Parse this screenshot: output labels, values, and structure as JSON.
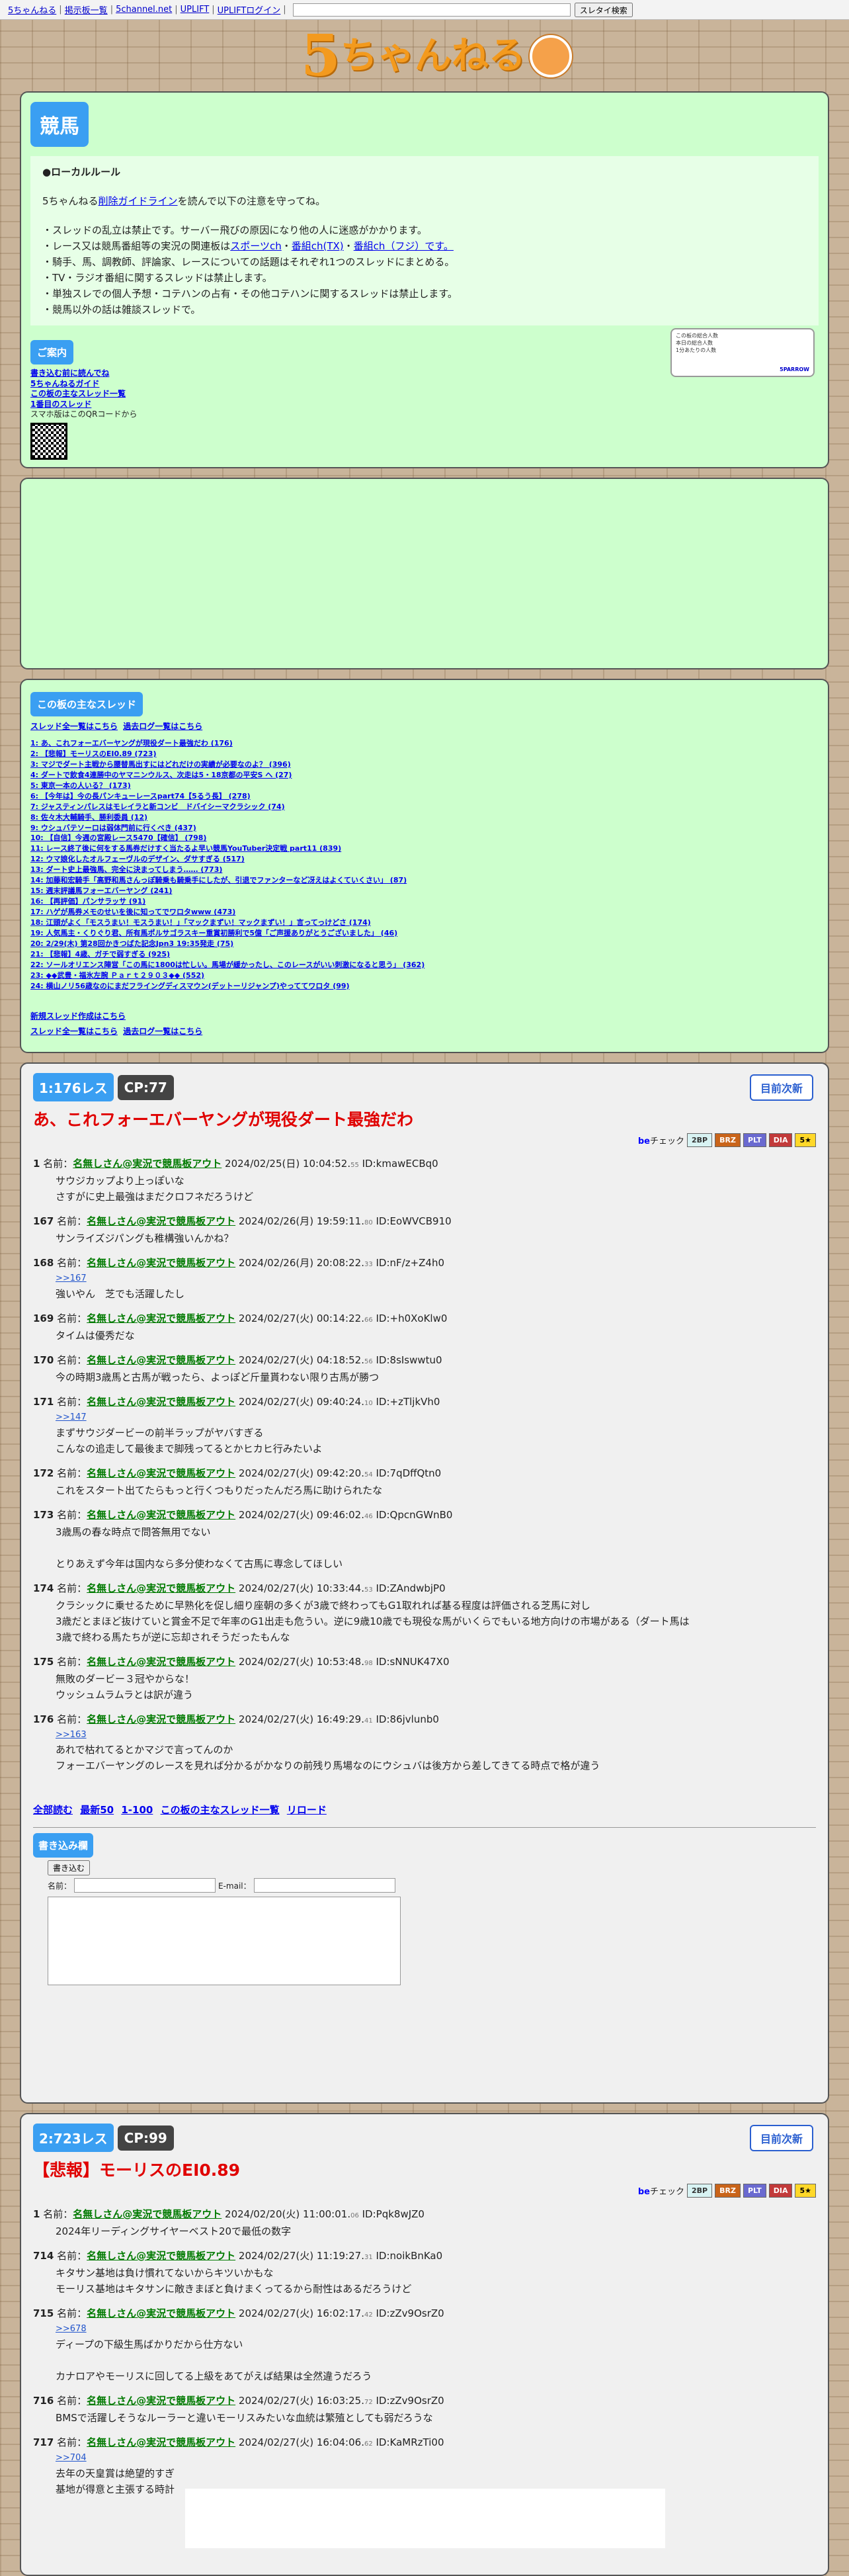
{
  "topbar": {
    "links": [
      "5ちゃんねる",
      "掲示板一覧",
      "5channel.net",
      "UPLIFT",
      "UPLIFTログイン"
    ],
    "search_placeholder": "",
    "search_button": "スレタイ検索"
  },
  "logo": {
    "text_big": "5",
    "text_rest": "ちゃんねる"
  },
  "board": {
    "title": "競馬",
    "rules_heading": "●ローカルルール",
    "rules_intro_pre": "5ちゃんねる",
    "rules_intro_link": "削除ガイドライン",
    "rules_intro_post": "を読んで以下の注意を守ってね。",
    "rule1": "・スレッドの乱立は禁止です。サーバー飛びの原因になり他の人に迷惑がかかります。",
    "rule2_pre": "・レース又は競馬番組等の実況の関連板は",
    "rule2_link1": "スポーツch",
    "rule2_sep1": "・",
    "rule2_link2": "番組ch(TX)",
    "rule2_sep2": "・",
    "rule2_link3": "番組ch（フジ）です。",
    "rule3": "・騎手、馬、調教師、評論家、レースについての話題はそれぞれ1つのスレッドにまとめる。",
    "rule4": "・TV・ラジオ番組に関するスレッドは禁止します。",
    "rule5": "・単独スレでの個人予想・コテハンの占有・その他コテハンに関するスレッドは禁止します。",
    "rule6": "・競馬以外の話は雑談スレッドで。"
  },
  "guide": {
    "tag": "ご案内",
    "links": [
      "書き込む前に読んでね",
      "5ちゃんねるガイド",
      "この板の主なスレッド一覧",
      "1番目のスレッド"
    ],
    "qr_note": "スマホ版はこのQRコードから"
  },
  "stats": {
    "line1": "この板の総合人数",
    "line2": "本日の総合人数",
    "line3": "1分あたりの人数",
    "link": "5PARROW"
  },
  "threads": {
    "tag": "この板の主なスレッド",
    "top_links": [
      "スレッド全一覧はこちら",
      "過去ログ一覧はこちら"
    ],
    "items": [
      "1: あ、これフォーエバーヤングが現役ダート最強だわ (176)",
      "2: 【悲報】モーリスのEI0.89 (723)",
      "3: マジでダート主戦から腰替馬出すにはどれだけの実績が必要なのよ？ (396)",
      "4: ダートで飲食4連勝中のヤマニンウルス、次走は5・18京都の平安S へ (27)",
      "5: 東京一本の人いる？ (173)",
      "6: 【今年は】今の長パンキューレースpart74【5るう長】 (278)",
      "7: ジャスティンパレスはモレイラと新コンビ　ドバイシーマクラシック (74)",
      "8: 佐々木大輔騎手、勝利委員 (12)",
      "9: ウシュバテソーロは弱体門前に行くべき (437)",
      "10: 【自信】今週の宮殿レース5470【確信】 (798)",
      "11: レース終了後に何をする馬券だけすく当たるよ早い競馬YouTuber決定戦 part11 (839)",
      "12: ウマ娘化したオルフェーヴルのデザイン、ダサすぎる (517)",
      "13: ダート史上最強馬、完全に決まってしまう…… (773)",
      "14: 加藤和宏騎手「高野和馬さんっぽ騎乗も騎乗手にしたが、引退でファンターなど冴えはよくていくさい」 (87)",
      "15: 週末評議馬フォーエバーヤング (241)",
      "16: 【再評価】パンサラッサ (91)",
      "17: ハゲが馬券メモのせいを後に知ってでワロタwww (473)",
      "18: 江頭がよく「モスうまい！モスうまい！」「マックまずい！マックまずい！」言ってっけどさ (174)",
      "19: 人気馬主・くりぐり君、所有馬ポルサゴラスキー重賞初勝利で5億「ご声援ありがとうございました」 (46)",
      "20: 2/29(木) 第28回かきつばた記念Jpn3 19:35発走 (75)",
      "21: 【悲報】4歳、ガチで弱すぎる (925)",
      "22: ソールオリエンス陣営「この馬に1800は忙しい。馬場が緩かったし、このレースがいい刺激になると思う」 (362)",
      "23: ◆◆武豊・福氷左腕 Ｐａｒｔ２９０３◆◆ (552)",
      "24: 横山ノリ56歳なのにまだフライングディスマウン(デットーリジャンプ)やっててワロタ (99)"
    ],
    "bottom_new": "新規スレッド作成はこちら",
    "bottom_links": [
      "スレッド全一覧はこちら",
      "過去ログ一覧はこちら"
    ]
  },
  "thread1": {
    "res_count": "1:176レス",
    "cp": "CP:77",
    "refresh": "目前次新",
    "title": "あ、これフォーエバーヤングが現役ダート最強だわ",
    "be_label": "be",
    "be_check": "チェック",
    "tags": [
      "2BP",
      "BRZ",
      "PLT",
      "DIA",
      "5★"
    ],
    "posts": [
      {
        "num": "1",
        "label": "名前：",
        "name": "名無しさん@実況で競馬板アウト",
        "date": "2024/02/25(日) 10:04:52.",
        "ms": "55",
        "id": "ID:kmawECBq0",
        "lines": [
          "サウジカップより上っぽいな",
          "さすがに史上最強はまだクロフネだろうけど"
        ]
      },
      {
        "num": "167",
        "label": "名前：",
        "name": "名無しさん@実況で競馬板アウト",
        "date": "2024/02/26(月) 19:59:11.",
        "ms": "80",
        "id": "ID:EoWVCB910",
        "lines": [
          "サンライズジパングも稚構強いんかね？"
        ]
      },
      {
        "num": "168",
        "label": "名前：",
        "name": "名無しさん@実況で競馬板アウト",
        "date": "2024/02/26(月) 20:08:22.",
        "ms": "33",
        "id": "ID:nF/z+Z4h0",
        "anchor": ">>167",
        "lines": [
          "強いやん　芝でも活躍したし"
        ]
      },
      {
        "num": "169",
        "label": "名前：",
        "name": "名無しさん@実況で競馬板アウト",
        "date": "2024/02/27(火) 00:14:22.",
        "ms": "66",
        "id": "ID:+h0XoKlw0",
        "lines": [
          "タイムは優秀だな"
        ]
      },
      {
        "num": "170",
        "label": "名前：",
        "name": "名無しさん@実況で競馬板アウト",
        "date": "2024/02/27(火) 04:18:52.",
        "ms": "56",
        "id": "ID:8sIswwtu0",
        "lines": [
          "今の時期3歳馬と古馬が戦ったら、よっぽど斤量貰わない限り古馬が勝つ"
        ]
      },
      {
        "num": "171",
        "label": "名前：",
        "name": "名無しさん@実況で競馬板アウト",
        "date": "2024/02/27(火) 09:40:24.",
        "ms": "10",
        "id": "ID:+zTljkVh0",
        "anchor": ">>147",
        "lines": [
          "まずサウジダービーの前半ラップがヤバすぎる",
          "こんなの追走して最後まで脚残ってるとかヒカヒ行みたいよ"
        ]
      },
      {
        "num": "172",
        "label": "名前：",
        "name": "名無しさん@実況で競馬板アウト",
        "date": "2024/02/27(火) 09:42:20.",
        "ms": "54",
        "id": "ID:7qDffQtn0",
        "lines": [
          "これをスタート出てたらもっと行くつもりだったんだろ馬に助けられたな"
        ]
      },
      {
        "num": "173",
        "label": "名前：",
        "name": "名無しさん@実況で競馬板アウト",
        "date": "2024/02/27(火) 09:46:02.",
        "ms": "46",
        "id": "ID:QpcnGWnB0",
        "lines": [
          "3歳馬の春な時点で問答無用でない",
          "",
          "とりあえず今年は国内なら多分使わなくて古馬に専念してほしい"
        ]
      },
      {
        "num": "174",
        "label": "名前：",
        "name": "名無しさん@実況で競馬板アウト",
        "date": "2024/02/27(火) 10:33:44.",
        "ms": "53",
        "id": "ID:ZAndwbjP0",
        "lines": [
          "クラシックに乗せるために早熟化を促し細り座朝の多くが3歳で終わってもG1取れれば基る程度は評価される芝馬に対し",
          "3歳だとまほど抜けていと賞金不足で年率のG1出走も危うい。逆に9歳10歳でも現役な馬がいくらでもいる地方向けの市場がある（ダート馬は",
          "3歳で終わる馬たちが逆に忘却されそうだったもんな"
        ]
      },
      {
        "num": "175",
        "label": "名前：",
        "name": "名無しさん@実況で競馬板アウト",
        "date": "2024/02/27(火) 10:53:48.",
        "ms": "98",
        "id": "ID:sNNUK47X0",
        "lines": [
          "無敗のダービー３冠やからな！",
          "ウッシュムラムラとは訳が違う"
        ]
      },
      {
        "num": "176",
        "label": "名前：",
        "name": "名無しさん@実況で競馬板アウト",
        "date": "2024/02/27(火) 16:49:29.",
        "ms": "41",
        "id": "ID:86jvlunb0",
        "anchor": ">>163",
        "lines": [
          "あれで枯れてるとかマジで言ってんのか",
          "フォーエバーヤングのレースを見れば分かるがかなりの前残り馬場なのにウシュバは後方から差してきてる時点で格が違う"
        ]
      }
    ],
    "foot_links": [
      "全部読む",
      "最新50",
      "1-100",
      "この板の主なスレッド一覧",
      "リロード"
    ],
    "write_tag": "書き込み欄",
    "submit": "書き込む",
    "name_label": "名前：",
    "email_label": "E-mail：",
    "name_value": "",
    "email_value": ""
  },
  "thread2": {
    "res_count": "2:723レス",
    "cp": "CP:99",
    "refresh": "目前次新",
    "title": "【悲報】モーリスのEI0.89",
    "be_label": "be",
    "be_check": "チェック",
    "tags": [
      "2BP",
      "BRZ",
      "PLT",
      "DIA",
      "5★"
    ],
    "posts": [
      {
        "num": "1",
        "label": "名前：",
        "name": "名無しさん@実況で競馬板アウト",
        "date": "2024/02/20(火) 11:00:01.",
        "ms": "06",
        "id": "ID:Pqk8wJZ0",
        "lines": [
          "2024年リーディングサイヤーベスト20で最低の数字"
        ]
      },
      {
        "num": "714",
        "label": "名前：",
        "name": "名無しさん@実況で競馬板アウト",
        "date": "2024/02/27(火) 11:19:27.",
        "ms": "31",
        "id": "ID:noikBnKa0",
        "lines": [
          "キタサン基地は負け慣れてないからキツいかもな",
          "モーリス基地はキタサンに敵きまぼと負けまくってるから耐性はあるだろうけど"
        ]
      },
      {
        "num": "715",
        "label": "名前：",
        "name": "名無しさん@実況で競馬板アウト",
        "date": "2024/02/27(火) 16:02:17.",
        "ms": "42",
        "id": "ID:zZv9OsrZ0",
        "anchor": ">>678",
        "lines": [
          "ディープの下級生馬ばかりだから仕方ない",
          "",
          "カナロアやモーリスに回してる上級をあてがえば結果は全然違うだろう"
        ]
      },
      {
        "num": "716",
        "label": "名前：",
        "name": "名無しさん@実況で競馬板アウト",
        "date": "2024/02/27(火) 16:03:25.",
        "ms": "72",
        "id": "ID:zZv9OsrZ0",
        "lines": [
          "BMSで活躍しそうなルーラーと違いモーリスみたいな血統は繁殖としても弱だろうな"
        ]
      },
      {
        "num": "717",
        "label": "名前：",
        "name": "名無しさん@実況で競馬板アウト",
        "date": "2024/02/27(火) 16:04:06.",
        "ms": "62",
        "id": "ID:KaMRzTi00",
        "anchor": ">>704",
        "lines": [
          "去年の天皇賞は絶望的すぎ",
          "基地が得意と主張する時計"
        ]
      }
    ]
  }
}
